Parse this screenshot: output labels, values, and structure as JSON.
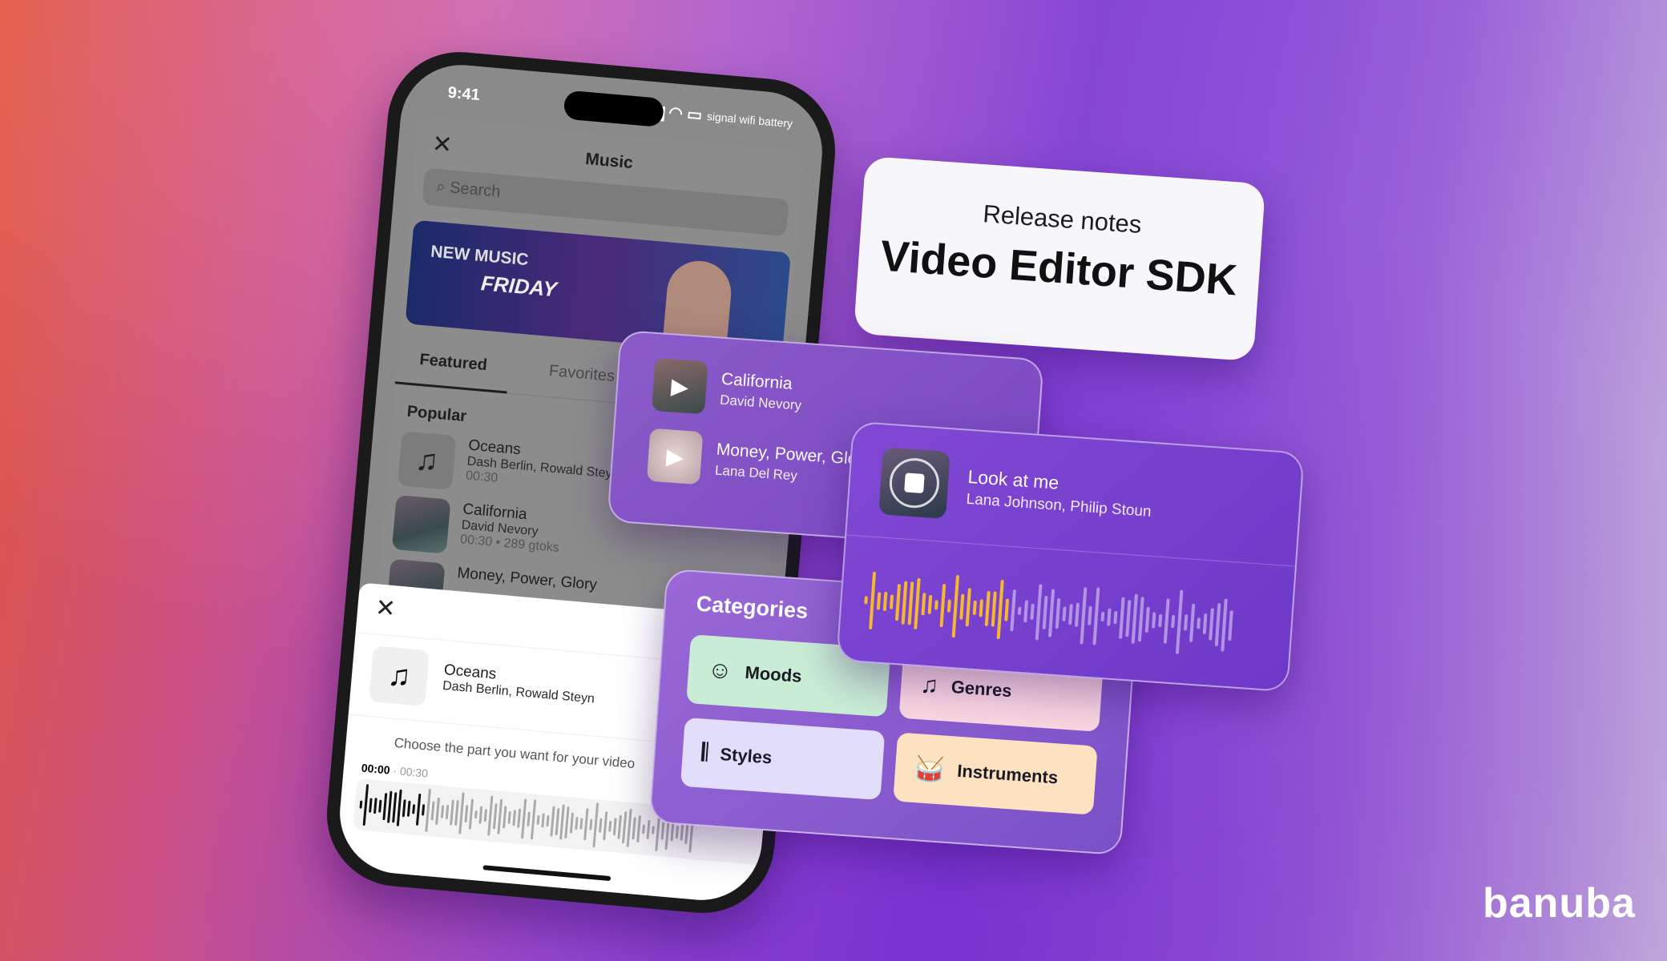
{
  "phone": {
    "status_time": "9:41",
    "status_icons": "signal wifi battery",
    "music_title": "Music",
    "search_placeholder": "Search",
    "banner": {
      "line1": "NEW MUSIC",
      "line2": "FRIDAY"
    },
    "tabs": [
      {
        "label": "Featured",
        "active": true
      },
      {
        "label": "Favorites",
        "active": false
      }
    ],
    "section": "Popular",
    "tracks": [
      {
        "title": "Oceans",
        "artist": "Dash Berlin, Rowald Steyn",
        "meta": "00:30",
        "icon": "music-note-icon"
      },
      {
        "title": "California",
        "artist": "David Nevory",
        "meta": "00:30 • 289 gtoks"
      },
      {
        "title": "Money, Power, Glory",
        "artist": "",
        "meta": ""
      }
    ],
    "selected": {
      "title": "Oceans",
      "artist": "Dash Berlin, Rowald Steyn"
    },
    "prompt": "Choose the part you want for your video",
    "time_start": "00:00",
    "time_sep": "·",
    "time_end": "00:30"
  },
  "release": {
    "line1": "Release notes",
    "line2": "Video Editor SDK"
  },
  "list_card": {
    "items": [
      {
        "title": "California",
        "artist": "David Nevory"
      },
      {
        "title": "Money, Power, Glory",
        "artist": "Lana Del Rey"
      }
    ]
  },
  "now_playing": {
    "title": "Look at me",
    "artist": "Lana Johnson, Philip Stoun",
    "progress": 0.38,
    "accent": "#f5b82e"
  },
  "categories": {
    "title": "Categories",
    "items": [
      {
        "label": "Moods",
        "icon": "smiley-icon",
        "color": "#c8ecd4"
      },
      {
        "label": "Genres",
        "icon": "music-notes-icon",
        "color": "#fad6e2"
      },
      {
        "label": "Styles",
        "icon": "waveform-icon",
        "color": "#e2ddfa"
      },
      {
        "label": "Instruments",
        "icon": "drum-icon",
        "color": "#fde2c2"
      }
    ]
  },
  "brand": "banuba"
}
